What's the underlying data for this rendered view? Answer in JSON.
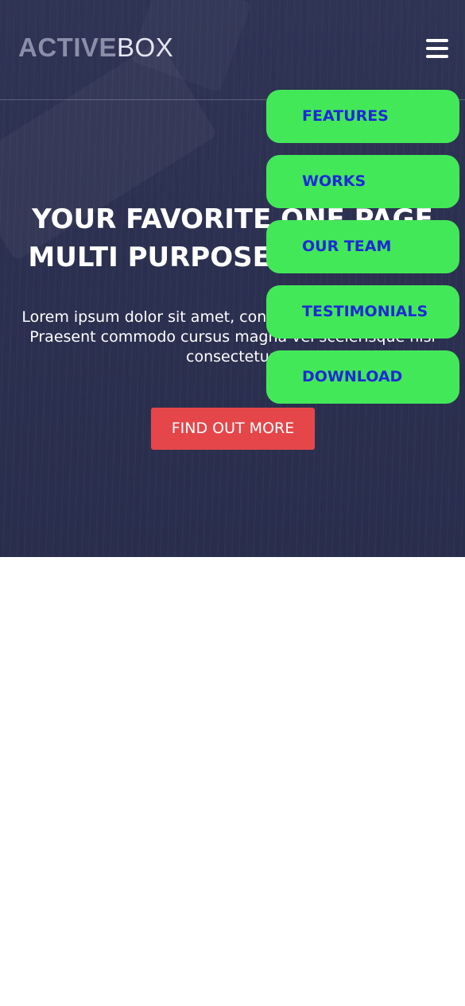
{
  "header": {
    "logo_bold": "ACTIVE",
    "logo_light": "BOX",
    "menu_icon": "hamburger-menu-icon"
  },
  "nav": {
    "items": [
      {
        "label": "FEATURES"
      },
      {
        "label": "WORKS"
      },
      {
        "label": "OUR TEAM"
      },
      {
        "label": "TESTIMONIALS"
      },
      {
        "label": "DOWNLOAD"
      }
    ]
  },
  "hero": {
    "title_line1": "YOUR FAVORITE ONE PAGE",
    "title_line2": "MULTI PURPOSE TEMPLATE",
    "text": "Lorem ipsum dolor sit amet, consectetur adipiscing elit. Praesent commodo cursus magna vel scelerisque nisl consectetur.",
    "cta_label": "FIND OUT MORE"
  },
  "colors": {
    "hero_background": "#2c3050",
    "nav_item_background": "#43e859",
    "nav_item_text": "#1d2ad6",
    "cta_background": "#e5464a"
  }
}
